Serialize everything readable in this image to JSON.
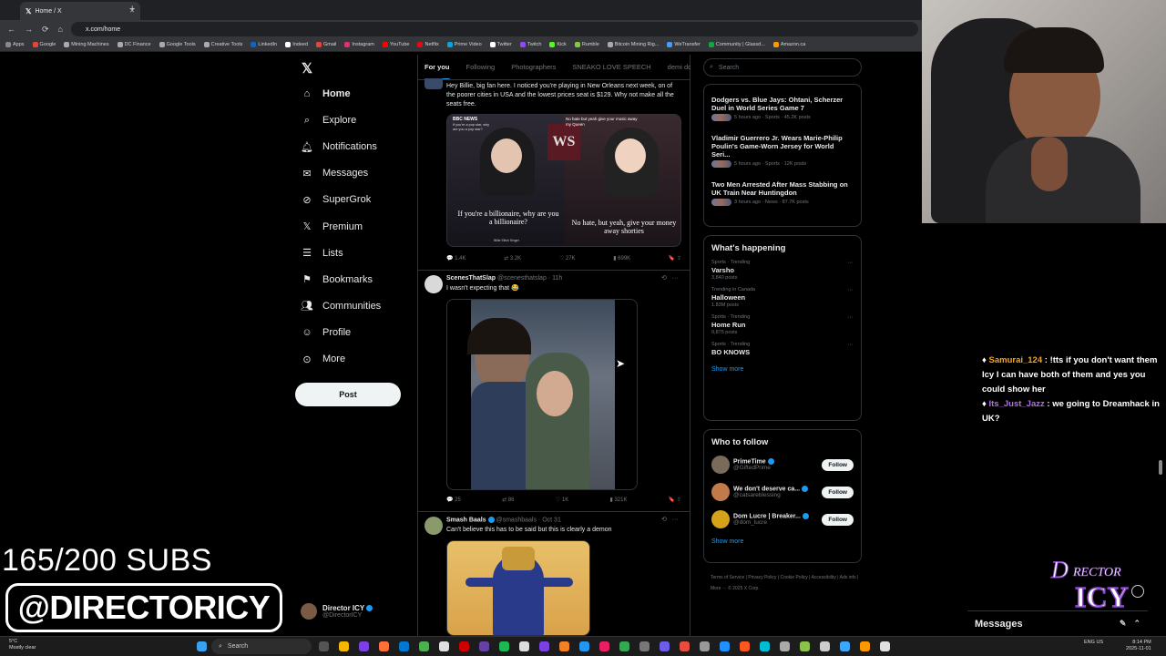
{
  "browser": {
    "tab_title": "Home / X",
    "url": "x.com/home",
    "bookmarks": [
      "Apps",
      "Google",
      "Mining Machines",
      "DC Finance",
      "Google Tools",
      "Creative Tools",
      "LinkedIn",
      "Indeed",
      "Gmail",
      "Instagram",
      "YouTube",
      "Netflix",
      "Prime Video",
      "Twitter",
      "Twitch",
      "Kick",
      "Rumble",
      "Bitcoin Mining Rig...",
      "WeTransfer",
      "Community | Glassd...",
      "Amazon.ca"
    ]
  },
  "nav": {
    "items": [
      {
        "label": "Home",
        "icon": "home-icon"
      },
      {
        "label": "Explore",
        "icon": "search-icon"
      },
      {
        "label": "Notifications",
        "icon": "bell-icon"
      },
      {
        "label": "Messages",
        "icon": "mail-icon"
      },
      {
        "label": "SuperGrok",
        "icon": "grok-icon"
      },
      {
        "label": "Premium",
        "icon": "x-premium-icon"
      },
      {
        "label": "Lists",
        "icon": "list-icon"
      },
      {
        "label": "Bookmarks",
        "icon": "bookmark-icon"
      },
      {
        "label": "Communities",
        "icon": "communities-icon"
      },
      {
        "label": "Profile",
        "icon": "person-icon"
      },
      {
        "label": "More",
        "icon": "more-circle-icon"
      }
    ],
    "post_label": "Post",
    "account": {
      "name": "Director ICY",
      "handle": "@DirectorICY"
    }
  },
  "feed": {
    "tabs": [
      "For you",
      "Following",
      "Photographers",
      "SNEAKO LOVE SPEECH",
      "demi dog"
    ],
    "tweet1": {
      "text": "Hey Billie, big fan here. I noticed you're playing in New Orleans next week, on of the poorer cities in USA and the lowest prices seat is $129. Why not make all the seats free.",
      "img_news": "BBC NEWS",
      "img_q_small": "If you're a pop star, why are you a pop star?",
      "img_caption_left": "If you're a billionaire, why are you a billionaire?",
      "img_caption_right": "No hate, but yeah, give your money away shorties",
      "img_top_right": "No hate but yeah give your music away my Queen",
      "img_credit": "Billie Eilish Singer",
      "replies": "1.4K",
      "reposts": "3.2K",
      "likes": "27K",
      "views": "699K"
    },
    "tweet2": {
      "name": "ScenesThatSlap",
      "handle": "@scenesthatslap",
      "time": "11h",
      "text": "I wasn't expecting that 😂",
      "replies": "25",
      "reposts": "86",
      "likes": "1K",
      "views": "321K"
    },
    "tweet3": {
      "name": "Smash Baals",
      "handle": "@smashbaals",
      "time": "Oct 31",
      "text": "Can't believe this has to be said but this is clearly a demon"
    }
  },
  "right": {
    "search_placeholder": "Search",
    "news": [
      {
        "title": "Dodgers vs. Blue Jays: Ohtani, Scherzer Duel in World Series Game 7",
        "meta": "5 hours ago · Sports · 45.2K posts"
      },
      {
        "title": "Vladimir Guerrero Jr. Wears Marie-Philip Poulin's Game-Worn Jersey for World Seri...",
        "meta": "5 hours ago · Sports · 12K posts"
      },
      {
        "title": "Two Men Arrested After Mass Stabbing on UK Train Near Huntingdon",
        "meta": "3 hours ago · News · 87.7K posts"
      }
    ],
    "happening_title": "What's happening",
    "trends": [
      {
        "meta": "Sports · Trending",
        "title": "Varsho",
        "posts": "3,840 posts"
      },
      {
        "meta": "Trending in Canada",
        "title": "Halloween",
        "posts": "1.83M posts"
      },
      {
        "meta": "Sports · Trending",
        "title": "Home Run",
        "posts": "9,875 posts"
      },
      {
        "meta": "Sports · Trending",
        "title": "BO KNOWS",
        "posts": ""
      }
    ],
    "show_more": "Show more",
    "follow_title": "Who to follow",
    "follow": [
      {
        "name": "PrimeTime",
        "handle": "@GiftedPrime",
        "color": "#7a6a5a"
      },
      {
        "name": "We don't deserve ca...",
        "handle": "@catsareblessing",
        "color": "#c27a4a"
      },
      {
        "name": "Dom Lucre | Breaker...",
        "handle": "@dom_lucre",
        "color": "#d6a21a"
      }
    ],
    "follow_label": "Follow",
    "footer": "Terms of Service | Privacy Policy | Cookie Policy | Accessibility | Ads info | More ··· © 2025 X Corp."
  },
  "overlay": {
    "chat": [
      {
        "user": "Samurai_124",
        "msg": ": !tts if you don't want them Icy I can have both of them and yes you could show her"
      },
      {
        "user": "Its_Just_Jazz",
        "msg": ": we going to Dreamhack in UK?"
      }
    ],
    "subs": "165/200 SUBS",
    "handle": "@DIRECTORICY",
    "messages_label": "Messages"
  },
  "taskbar": {
    "search": "Search",
    "weather_temp": "5°C",
    "weather_desc": "Mostly clear",
    "lang": "ENG US",
    "time": "8:14 PM",
    "date": "2025-11-01"
  }
}
